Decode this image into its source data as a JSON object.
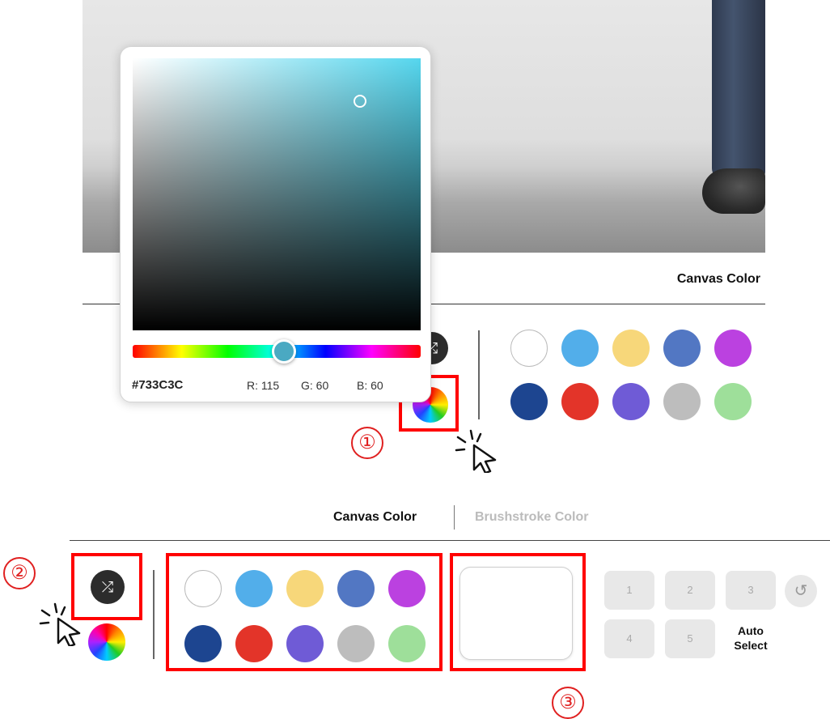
{
  "header": {
    "canvas_color_label": "Canvas Color"
  },
  "picker": {
    "hex": "#733C3C",
    "r_label": "R: 115",
    "g_label": "G: 60",
    "b_label": "B: 60",
    "sv_base_color": "#55d6ee",
    "hue_handle_color": "#4aa9c2"
  },
  "swatches": {
    "colors": [
      "#ffffff",
      "#52aeea",
      "#f7d77a",
      "#5277c3",
      "#bb41e0",
      "#1d4590",
      "#e33429",
      "#6f5bd6",
      "#bdbdbd",
      "#9edf9a"
    ]
  },
  "tabs": {
    "canvas": "Canvas Color",
    "brushstroke": "Brushstroke Color"
  },
  "slots": {
    "s1": "1",
    "s2": "2",
    "s3": "3",
    "s4": "4",
    "s5": "5"
  },
  "auto_select": "Auto\nSelect",
  "annotations": {
    "n1": "①",
    "n2": "②",
    "n3": "③"
  },
  "icons": {
    "shuffle": "shuffle-icon",
    "wheel": "color-wheel-icon",
    "undo": "undo-icon",
    "cursor": "click-cursor-icon"
  },
  "highlight_color": "#ff0000"
}
